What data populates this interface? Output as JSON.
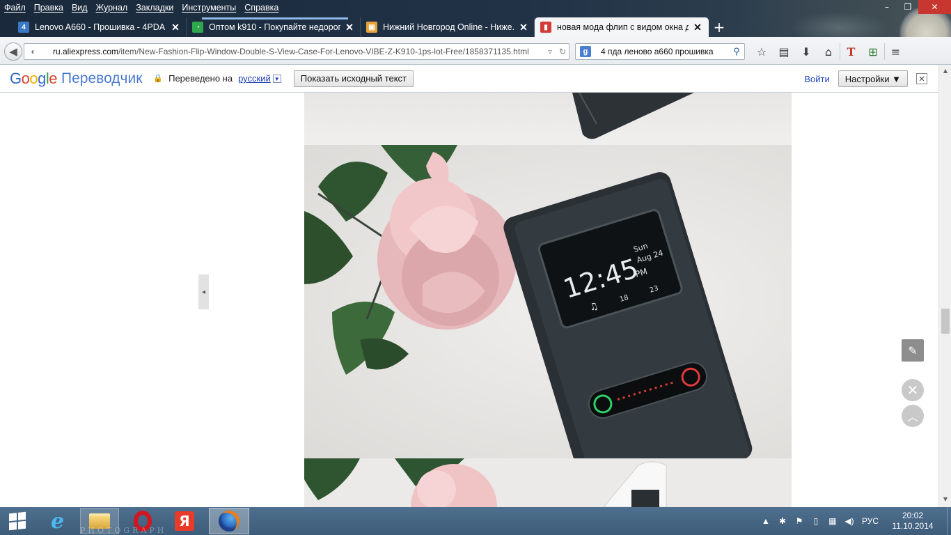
{
  "menu": [
    "Файл",
    "Правка",
    "Вид",
    "Журнал",
    "Закладки",
    "Инструменты",
    "Справка"
  ],
  "window_controls": {
    "minimize": "–",
    "restore": "❐",
    "close": "✕"
  },
  "tabs": [
    {
      "title": "Lenovo A660 - Прошивка - 4PDA",
      "close": "✕",
      "icon_color": "#3b78c3",
      "icon_glyph": "4"
    },
    {
      "title": "Оптом k910 - Покупайте недорог...",
      "close": "✕",
      "icon_color": "#2ea64b",
      "icon_glyph": "◔"
    },
    {
      "title": "Нижний Новгород Online - Ниже...",
      "close": "✕",
      "icon_color": "#e8a23a",
      "icon_glyph": "▣"
    },
    {
      "title": "новая мода флип с видом окна д...",
      "close": "✕",
      "icon_color": "#d23b36",
      "icon_glyph": "🛒"
    }
  ],
  "new_tab": "+",
  "urlbar": {
    "domain": "ru.aliexpress.com",
    "path": "/item/New-Fashion-Flip-Window-Double-S-View-Case-For-Lenovo-VIBE-Z-K910-1ps-lot-Free/1858371135.html"
  },
  "searchbar": {
    "engine": "g",
    "query": "4 пда леново а660 прошивка",
    "go": "🔍"
  },
  "toolbar_icons": [
    "☆",
    "▤",
    "⬇",
    "⌂",
    "T",
    "⊞",
    "≡"
  ],
  "translate_bar": {
    "logo": [
      "G",
      "o",
      "o",
      "g",
      "l",
      "e"
    ],
    "product": "Переводчик",
    "translated_label": "Переведено на",
    "language": "русский",
    "show_original": "Показать исходный текст",
    "signin": "Войти",
    "settings": "Настройки ▼",
    "close": "✕"
  },
  "page": {
    "collapse_arrow": "◂",
    "edit_icon": "✎",
    "close_icon": "✕",
    "up_icon": "︿"
  },
  "phone_screen": {
    "time": "12:45",
    "ampm": "PM",
    "day": "Sun",
    "date": "Aug 24",
    "msgs": "18",
    "missed": "23"
  },
  "taskbar": {
    "watermark": "PHOTOGRAPH",
    "yandex": "Я",
    "tray_lang": "РУС",
    "time": "20:02",
    "date": "11.10.2014"
  }
}
